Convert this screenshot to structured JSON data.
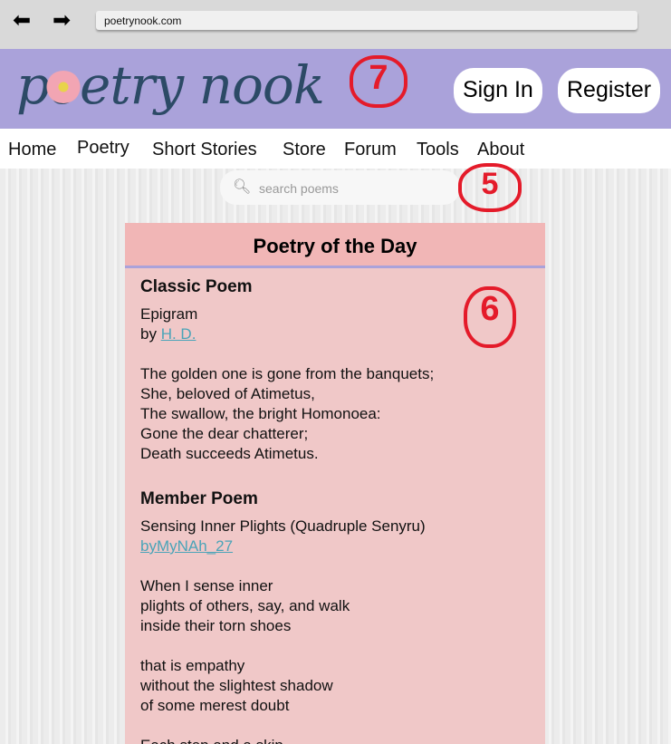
{
  "browser": {
    "url": "poetrynook.com"
  },
  "header": {
    "logo": "poetry nook",
    "sign_in": "Sign In",
    "register": "Register"
  },
  "annotations": [
    "7",
    "5",
    "6"
  ],
  "nav": [
    "Home",
    "Poetry",
    "Short Stories",
    "Store",
    "Forum",
    "Tools",
    "About"
  ],
  "search": {
    "placeholder": "search poems"
  },
  "card": {
    "title": "Poetry of the Day",
    "classic": {
      "heading": "Classic Poem",
      "title": "Epigram",
      "by": "by ",
      "author": "H. D.",
      "lines": [
        "The golden one is gone from the banquets;",
        "She, beloved of Atimetus,",
        "The swallow, the bright Homonoea:",
        "Gone the dear chatterer;",
        "Death succeeds Atimetus."
      ]
    },
    "member": {
      "heading": "Member Poem",
      "title": "Sensing Inner Plights (Quadruple Senyru)",
      "author": "byMyNAh_27",
      "stanza1": [
        "When I sense inner",
        "plights of others, say, and walk",
        "inside their torn shoes"
      ],
      "stanza2": [
        "that is empathy",
        "without the slightest shadow",
        "of some merest doubt"
      ],
      "stanza3": [
        "Each step and a skip"
      ]
    }
  }
}
